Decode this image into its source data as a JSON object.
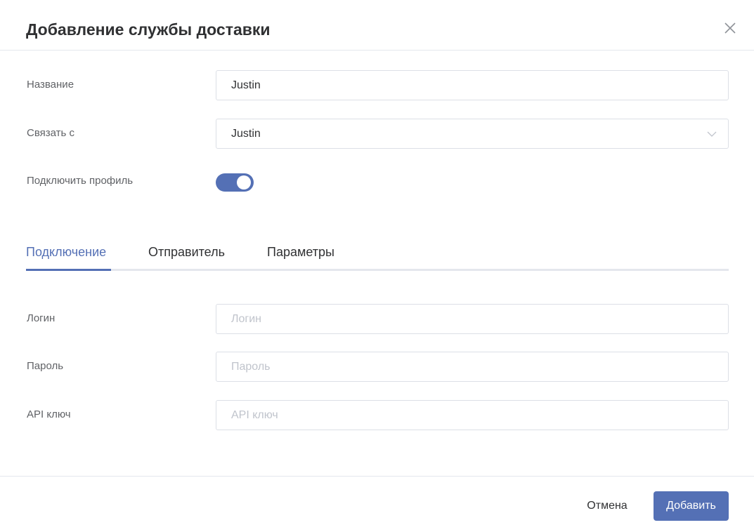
{
  "dialog": {
    "title": "Добавление службы доставки"
  },
  "form": {
    "name": {
      "label": "Название",
      "value": "Justin"
    },
    "link": {
      "label": "Связать с",
      "selected": "Justin"
    },
    "profile": {
      "label": "Подключить профиль",
      "enabled": true
    }
  },
  "tabs": [
    {
      "label": "Подключение",
      "active": true
    },
    {
      "label": "Отправитель",
      "active": false
    },
    {
      "label": "Параметры",
      "active": false
    }
  ],
  "connection": {
    "login": {
      "label": "Логин",
      "placeholder": "Логин",
      "value": ""
    },
    "password": {
      "label": "Пароль",
      "placeholder": "Пароль",
      "value": ""
    },
    "api_key": {
      "label": "API ключ",
      "placeholder": "API ключ",
      "value": ""
    }
  },
  "footer": {
    "cancel_label": "Отмена",
    "submit_label": "Добавить"
  },
  "colors": {
    "accent": "#5470b5",
    "border": "#dcdfe6",
    "placeholder": "#c0c4cc"
  },
  "icons": {
    "close": "close-icon",
    "select_arrow": "chevron-down-icon"
  }
}
